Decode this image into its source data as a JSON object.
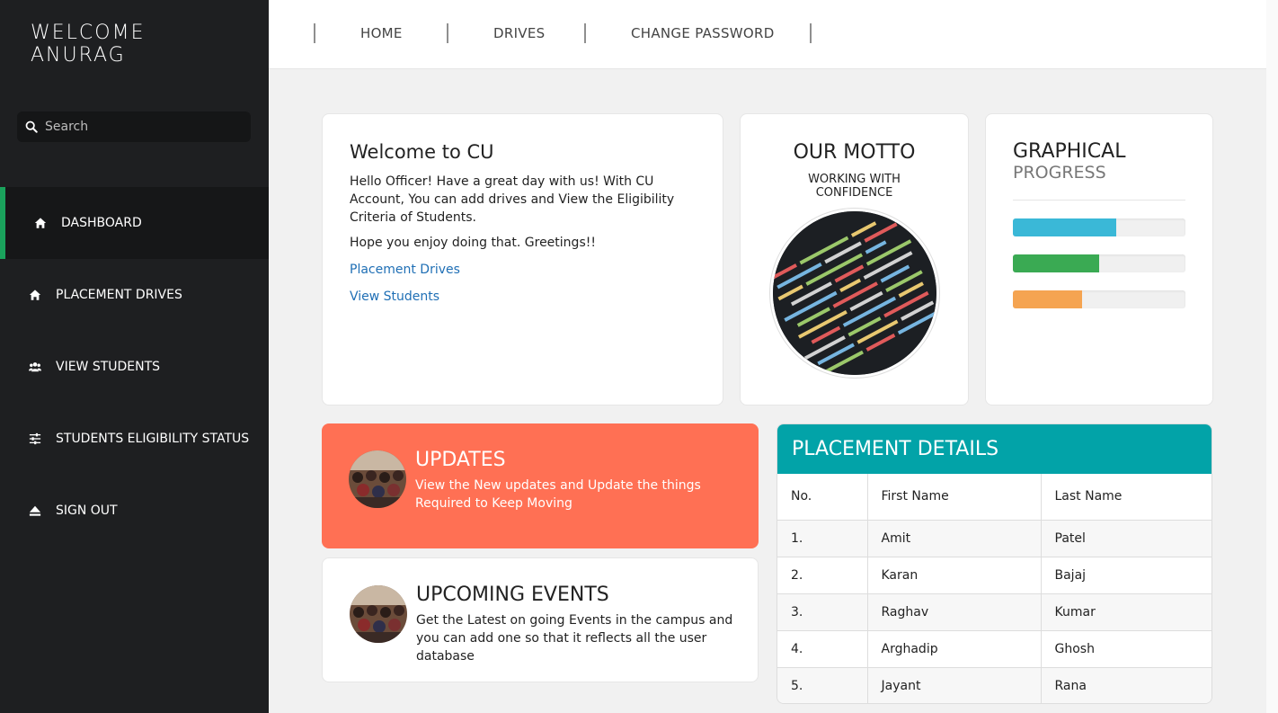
{
  "sidebar": {
    "brand_line1": "WELCOME",
    "brand_line2": "ANURAG",
    "search_placeholder": "Search",
    "items": [
      {
        "label": "DASHBOARD",
        "icon": "home-icon",
        "active": true
      },
      {
        "label": "PLACEMENT DRIVES",
        "icon": "home-icon",
        "active": false
      },
      {
        "label": "VIEW STUDENTS",
        "icon": "users-icon",
        "active": false
      },
      {
        "label": "STUDENTS ELIGIBILITY STATUS",
        "icon": "sliders-icon",
        "active": false
      },
      {
        "label": "SIGN OUT",
        "icon": "eject-icon",
        "active": false
      }
    ]
  },
  "topnav": {
    "links": [
      "HOME",
      "DRIVES",
      "CHANGE PASSWORD"
    ]
  },
  "welcome_card": {
    "title": "Welcome to CU",
    "text": "Hello Officer! Have a great day with us! With CU Account, You can add drives and View the Eligibility Criteria of Students.",
    "hope": "Hope you enjoy doing that. Greetings!!",
    "link1": "Placement Drives",
    "link2": "View Students"
  },
  "motto_card": {
    "title": "OUR MOTTO",
    "sub_line1": "WORKING WITH",
    "sub_line2": "CONFIDENCE"
  },
  "graph_card": {
    "title": "GRAPHICAL",
    "subtitle": "PROGRESS",
    "bars": [
      {
        "value": 0.6,
        "color": "#3ab8d7"
      },
      {
        "value": 0.5,
        "color": "#3aaa53"
      },
      {
        "value": 0.4,
        "color": "#f5a451"
      }
    ]
  },
  "updates_card": {
    "title": "UPDATES",
    "text": "View the New updates and Update the things Required to Keep Moving"
  },
  "events_card": {
    "title": "UPCOMING EVENTS",
    "text": "Get the Latest on going Events in the campus and you can add one so that it reflects all the user database"
  },
  "placement": {
    "title": "PLACEMENT DETAILS",
    "headers": [
      "No.",
      "First Name",
      "Last Name"
    ],
    "rows": [
      [
        "1.",
        "Amit",
        "Patel"
      ],
      [
        "2.",
        "Karan",
        "Bajaj"
      ],
      [
        "3.",
        "Raghav",
        "Kumar"
      ],
      [
        "4.",
        "Arghadip",
        "Ghosh"
      ],
      [
        "5.",
        "Jayant",
        "Rana"
      ]
    ]
  },
  "colors": {
    "sidebar_bg": "#1e1f21",
    "active_accent": "#1aa25c",
    "updates_bg": "#ff7054",
    "table_header_bg": "#02a3a8",
    "link": "#1f6fb5"
  }
}
